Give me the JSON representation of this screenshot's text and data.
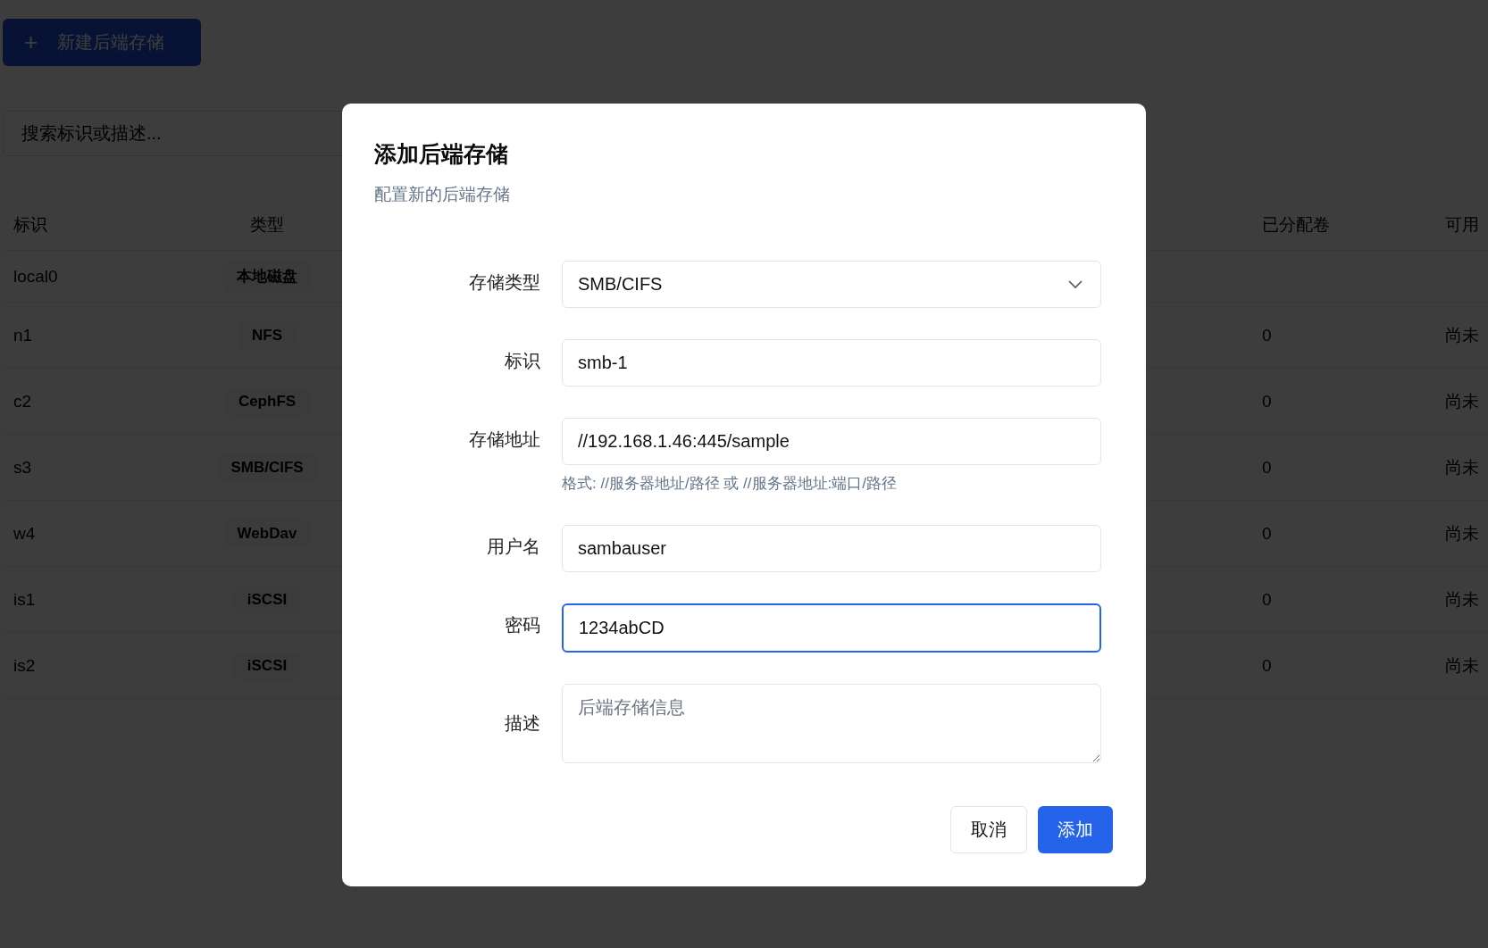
{
  "page": {
    "new_button": {
      "icon": "+",
      "label": "新建后端存储"
    },
    "search": {
      "placeholder": "搜索标识或描述..."
    },
    "table": {
      "columns": [
        "标识",
        "类型",
        "已分配卷",
        "可用"
      ],
      "rows": [
        {
          "id": "local0",
          "type": "本地磁盘"
        },
        {
          "id": "n1",
          "type": "NFS",
          "allocated": "0",
          "available": "尚未"
        },
        {
          "id": "c2",
          "type": "CephFS",
          "allocated": "0",
          "available": "尚未"
        },
        {
          "id": "s3",
          "type": "SMB/CIFS",
          "allocated": "0",
          "available": "尚未"
        },
        {
          "id": "w4",
          "type": "WebDav",
          "allocated": "0",
          "available": "尚未"
        },
        {
          "id": "is1",
          "type": "iSCSI",
          "allocated": "0",
          "available": "尚未"
        },
        {
          "id": "is2",
          "type": "iSCSI",
          "allocated": "0",
          "available": "尚未"
        }
      ]
    }
  },
  "dialog": {
    "title": "添加后端存储",
    "subtitle": "配置新的后端存储",
    "fields": [
      {
        "kind": "select",
        "label": "存储类型",
        "value": "SMB/CIFS",
        "focused": false
      },
      {
        "kind": "text",
        "label": "标识",
        "value": "smb-1",
        "focused": false
      },
      {
        "kind": "text",
        "label": "存储地址",
        "value": "//192.168.1.46:445/sample",
        "hint": "格式: //服务器地址/路径 或 //服务器地址:端口/路径",
        "focused": false
      },
      {
        "kind": "text",
        "label": "用户名",
        "value": "sambauser",
        "focused": false
      },
      {
        "kind": "text",
        "label": "密码",
        "value": "1234abCD",
        "focused": true
      },
      {
        "kind": "textarea",
        "label": "描述",
        "placeholder": "后端存储信息",
        "focused": false
      }
    ],
    "buttons": [
      {
        "kind": "secondary",
        "label": "取消"
      },
      {
        "kind": "primary",
        "label": "添加"
      }
    ]
  }
}
